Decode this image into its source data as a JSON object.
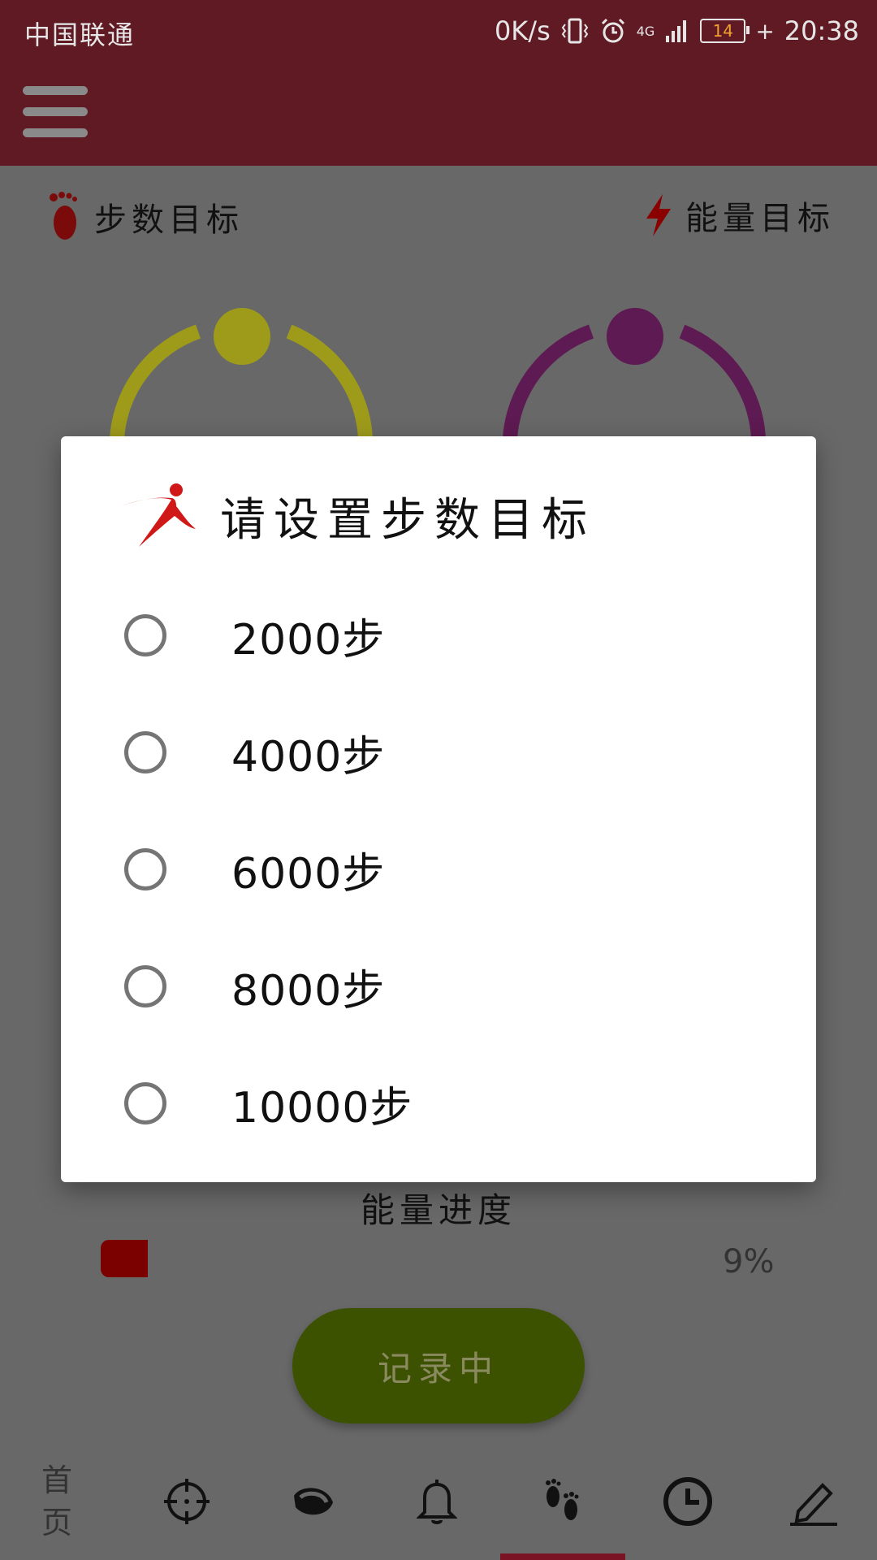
{
  "status_bar": {
    "carrier": "中国联通",
    "net_speed": "0K/s",
    "network": "4G",
    "battery": "14",
    "time": "20:38"
  },
  "goals": {
    "steps_label": "步数目标",
    "energy_label": "能量目标"
  },
  "colors": {
    "app_bar": "#5f1a24",
    "step_ring": "#9e9b1b",
    "energy_ring": "#5e1a52",
    "record_button": "#3d5200",
    "progress_fill": "#7b0000"
  },
  "energy_progress": {
    "label": "能量进度",
    "percent_text": "9%",
    "value": 0.09
  },
  "record_button": {
    "label": "记录中"
  },
  "bottom_nav": {
    "home_label_line1": "首",
    "home_label_line2": "页",
    "icons": [
      "crosshair-icon",
      "band-icon",
      "bell-icon",
      "footprints-icon",
      "clock-icon",
      "pencil-icon"
    ]
  },
  "dialog": {
    "title": "请设置步数目标",
    "options": [
      {
        "label": "2000步",
        "selected": false
      },
      {
        "label": "4000步",
        "selected": false
      },
      {
        "label": "6000步",
        "selected": false
      },
      {
        "label": "8000步",
        "selected": false
      },
      {
        "label": "10000步",
        "selected": false
      }
    ]
  }
}
